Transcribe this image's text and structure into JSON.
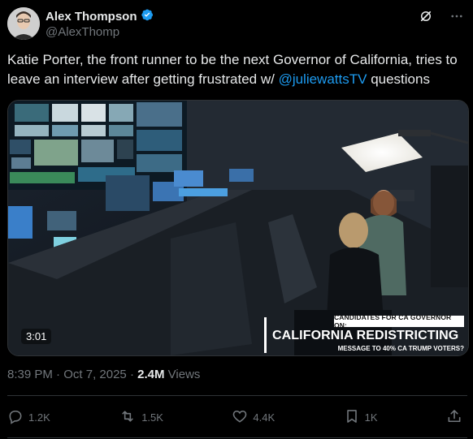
{
  "author": {
    "name": "Alex Thompson",
    "handle": "@AlexThomp",
    "verified": true,
    "verified_color": "#1d9bf0"
  },
  "tweet": {
    "text_before": "Katie Porter, the front runner to be the next Governor of California, tries to leave an interview after getting frustrated w/ ",
    "mention": "@juliewattsTV",
    "text_after": " questions"
  },
  "media": {
    "duration": "3:01",
    "chyron_top": "CANDIDATES FOR CA GOVERNOR ON:",
    "chyron_main": "CALIFORNIA REDISTRICTING",
    "chyron_sub": "MESSAGE TO 40% CA TRUMP VOTERS?"
  },
  "meta": {
    "time": "8:39 PM",
    "separator": "·",
    "date": "Oct 7, 2025",
    "separator2": "·",
    "views_count": "2.4M",
    "views_label": "Views"
  },
  "actions": {
    "replies": "1.2K",
    "reposts": "1.5K",
    "likes": "4.4K",
    "bookmarks": "1K"
  },
  "icons": {
    "grok": "grok-icon",
    "more": "more-icon",
    "reply": "reply-icon",
    "repost": "repost-icon",
    "like": "like-icon",
    "bookmark": "bookmark-icon",
    "share": "share-icon"
  },
  "colors": {
    "background": "#000000",
    "text": "#e7e9ea",
    "muted": "#71767b",
    "accent": "#1d9bf0",
    "border": "#2f3336"
  }
}
